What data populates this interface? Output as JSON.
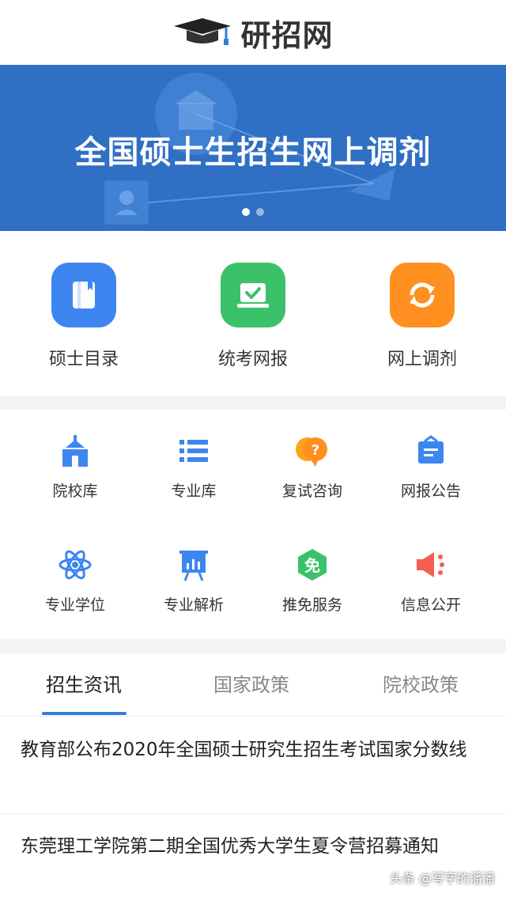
{
  "header": {
    "title": "研招网",
    "logo_icon": "graduation-cap-icon"
  },
  "banner": {
    "headline": "全国硕士生招生网上调剂",
    "slide_count": 2,
    "active_slide": 0,
    "color": "#2f6fc4"
  },
  "quick_links": [
    {
      "label": "硕士目录",
      "icon": "book-icon",
      "color": "#3d86f0"
    },
    {
      "label": "统考网报",
      "icon": "laptop-check-icon",
      "color": "#3cc16b"
    },
    {
      "label": "网上调剂",
      "icon": "refresh-icon",
      "color": "#ff8f1f"
    }
  ],
  "services": [
    {
      "label": "院校库",
      "icon": "school-icon"
    },
    {
      "label": "专业库",
      "icon": "list-icon"
    },
    {
      "label": "复试咨询",
      "icon": "question-chat-icon"
    },
    {
      "label": "网报公告",
      "icon": "notice-icon"
    },
    {
      "label": "专业学位",
      "icon": "atom-icon"
    },
    {
      "label": "专业解析",
      "icon": "presentation-icon"
    },
    {
      "label": "推免服务",
      "icon": "exempt-icon",
      "badge": "免"
    },
    {
      "label": "信息公开",
      "icon": "megaphone-icon"
    }
  ],
  "tabs": [
    {
      "label": "招生资讯",
      "active": true
    },
    {
      "label": "国家政策",
      "active": false
    },
    {
      "label": "院校政策",
      "active": false
    }
  ],
  "news": [
    {
      "title": "教育部公布2020年全国硕士研究生招生考试国家分数线"
    },
    {
      "title": "东莞理工学院第二期全国优秀大学生夏令营招募通知"
    }
  ],
  "watermark": "头条 @写字的潘潘",
  "colors": {
    "accent": "#2f7fd8",
    "banner": "#2f6fc4"
  }
}
